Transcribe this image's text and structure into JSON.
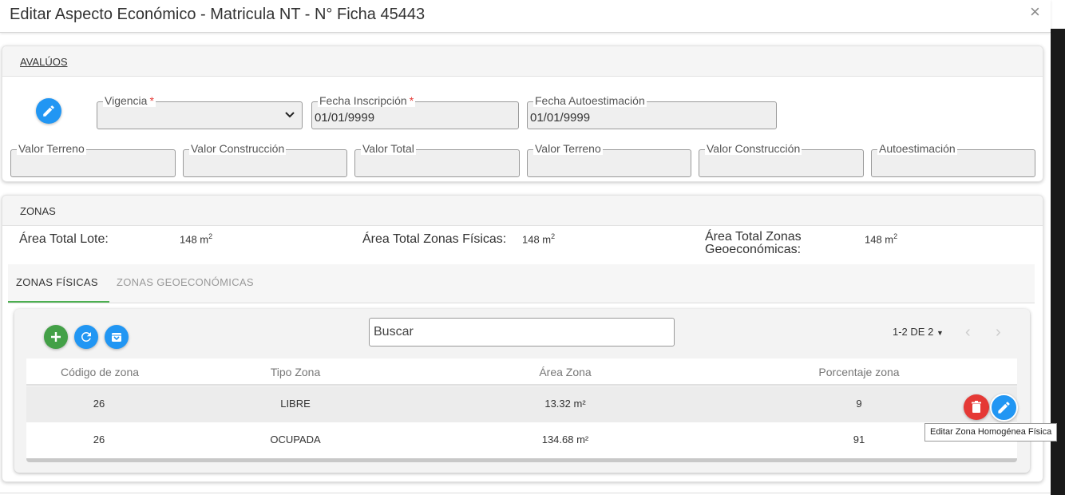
{
  "dialog": {
    "title": "Editar Aspecto Económico - Matricula NT - N° Ficha 45443",
    "close": "×"
  },
  "avaluos": {
    "heading": "AVALÚOS",
    "vigencia": {
      "label": "Vigencia",
      "value": ""
    },
    "fecha_inscripcion": {
      "label": "Fecha Inscripción",
      "value": "01/01/9999"
    },
    "fecha_autoestimacion": {
      "label": "Fecha Autoestimación",
      "value": "01/01/9999"
    },
    "required_mark": "*",
    "row2": [
      {
        "label": "Valor Terreno",
        "value": ""
      },
      {
        "label": "Valor Construcción",
        "value": ""
      },
      {
        "label": "Valor Total",
        "value": ""
      },
      {
        "label": "Valor Terreno",
        "value": ""
      },
      {
        "label": "Valor Construcción",
        "value": ""
      },
      {
        "label": "Autoestimación",
        "value": ""
      }
    ]
  },
  "zonas": {
    "heading": "ZONAS",
    "area_lote_label": "Área Total Lote:",
    "area_lote_value": "148 m",
    "area_fisicas_label": "Área Total Zonas Físicas:",
    "area_fisicas_value": "148 m",
    "area_geo_label_1": "Área Total Zonas",
    "area_geo_label_2": "Geoeconómicas:",
    "area_geo_value": "148 m",
    "sup": "2",
    "tabs": [
      {
        "label": "ZONAS FÍSICAS",
        "active": true
      },
      {
        "label": "ZONAS GEOECONÓMICAS",
        "active": false
      }
    ]
  },
  "table": {
    "search_placeholder": "Buscar",
    "pagination": "1-2 DE 2",
    "headers": [
      "Código de zona",
      "Tipo Zona",
      "Área Zona",
      "Porcentaje zona"
    ],
    "rows": [
      {
        "codigo": "26",
        "tipo": "LIBRE",
        "area": "13.32 m²",
        "porcentaje": "9"
      },
      {
        "codigo": "26",
        "tipo": "OCUPADA",
        "area": "134.68 m²",
        "porcentaje": "91"
      }
    ]
  },
  "tooltip": "Editar Zona Homogénea Física",
  "colors": {
    "accent_blue": "#2196f3",
    "add_green": "#43a047",
    "delete_red": "#e53935",
    "tab_active": "#4caf50"
  }
}
